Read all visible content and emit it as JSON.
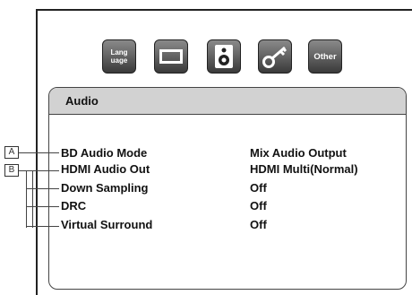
{
  "toolbar": {
    "items": [
      {
        "label": "Lang\nuage",
        "icon": "language-icon"
      },
      {
        "label": "",
        "icon": "display-icon"
      },
      {
        "label": "",
        "icon": "speaker-icon"
      },
      {
        "label": "",
        "icon": "key-icon"
      },
      {
        "label": "Other",
        "icon": "other-icon"
      }
    ],
    "lang_line1": "Lang",
    "lang_line2": "uage",
    "other_label": "Other"
  },
  "panel": {
    "title": "Audio",
    "rows": [
      {
        "label": "BD Audio Mode",
        "value": "Mix Audio Output"
      },
      {
        "label": "HDMI Audio Out",
        "value": "HDMI Multi(Normal)"
      },
      {
        "label": "Down Sampling",
        "value": "Off"
      },
      {
        "label": "DRC",
        "value": "Off"
      },
      {
        "label": "Virtual Surround",
        "value": "Off"
      }
    ]
  },
  "callouts": {
    "a": "A",
    "b": "B"
  },
  "colors": {
    "header_bg": "#d2d2d2",
    "button_dark": "#3a3a3a",
    "button_light": "#8a8a8a"
  }
}
